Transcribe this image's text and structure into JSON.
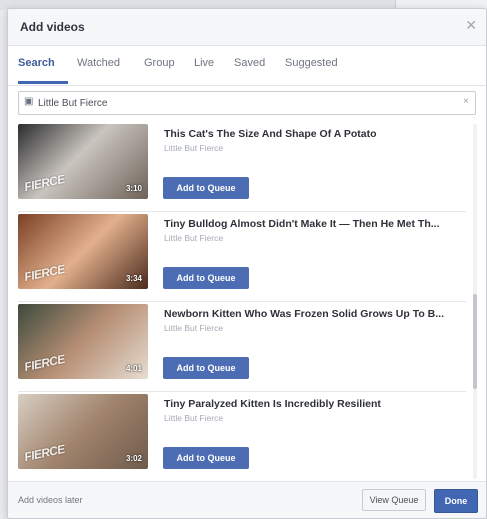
{
  "dialog": {
    "title": "Add videos",
    "close_icon": "close-icon"
  },
  "tabs": [
    {
      "label": "Search",
      "active": true
    },
    {
      "label": "Watched",
      "active": false
    },
    {
      "label": "Group",
      "active": false
    },
    {
      "label": "Live",
      "active": false
    },
    {
      "label": "Saved",
      "active": false
    },
    {
      "label": "Suggested",
      "active": false
    }
  ],
  "search": {
    "value": "Little But Fierce",
    "icon": "page-icon"
  },
  "videos": [
    {
      "title": "This Cat's The Size And Shape Of A Potato",
      "source": "Little But Fierce",
      "duration": "3:10",
      "thumb_word": "FIERCE",
      "button": "Add to Queue",
      "thumb_colors": [
        "#2b2b2e",
        "#c9c4be",
        "#6e6259"
      ]
    },
    {
      "title": "Tiny Bulldog Almost Didn't Make It — Then He Met Th...",
      "source": "Little But Fierce",
      "duration": "3:34",
      "thumb_word": "FIERCE",
      "button": "Add to Queue",
      "thumb_colors": [
        "#7a3f25",
        "#e2b08c",
        "#4b2b1e"
      ]
    },
    {
      "title": "Newborn Kitten Who Was Frozen Solid Grows Up To B...",
      "source": "Little But Fierce",
      "duration": "4:01",
      "thumb_word": "FIERCE",
      "button": "Add to Queue",
      "thumb_colors": [
        "#3d4a3c",
        "#b78f75",
        "#e7ddd2"
      ]
    },
    {
      "title": "Tiny Paralyzed Kitten Is Incredibly Resilient",
      "source": "Little But Fierce",
      "duration": "3:02",
      "thumb_word": "FIERCE",
      "button": "Add to Queue",
      "thumb_colors": [
        "#d8cec3",
        "#a1846d",
        "#6f5b4b"
      ]
    }
  ],
  "footer": {
    "add_later": "Add videos later",
    "view_queue": "View Queue",
    "done": "Done"
  },
  "colors": {
    "accent": "#4267b2",
    "button": "#4c6db4"
  }
}
